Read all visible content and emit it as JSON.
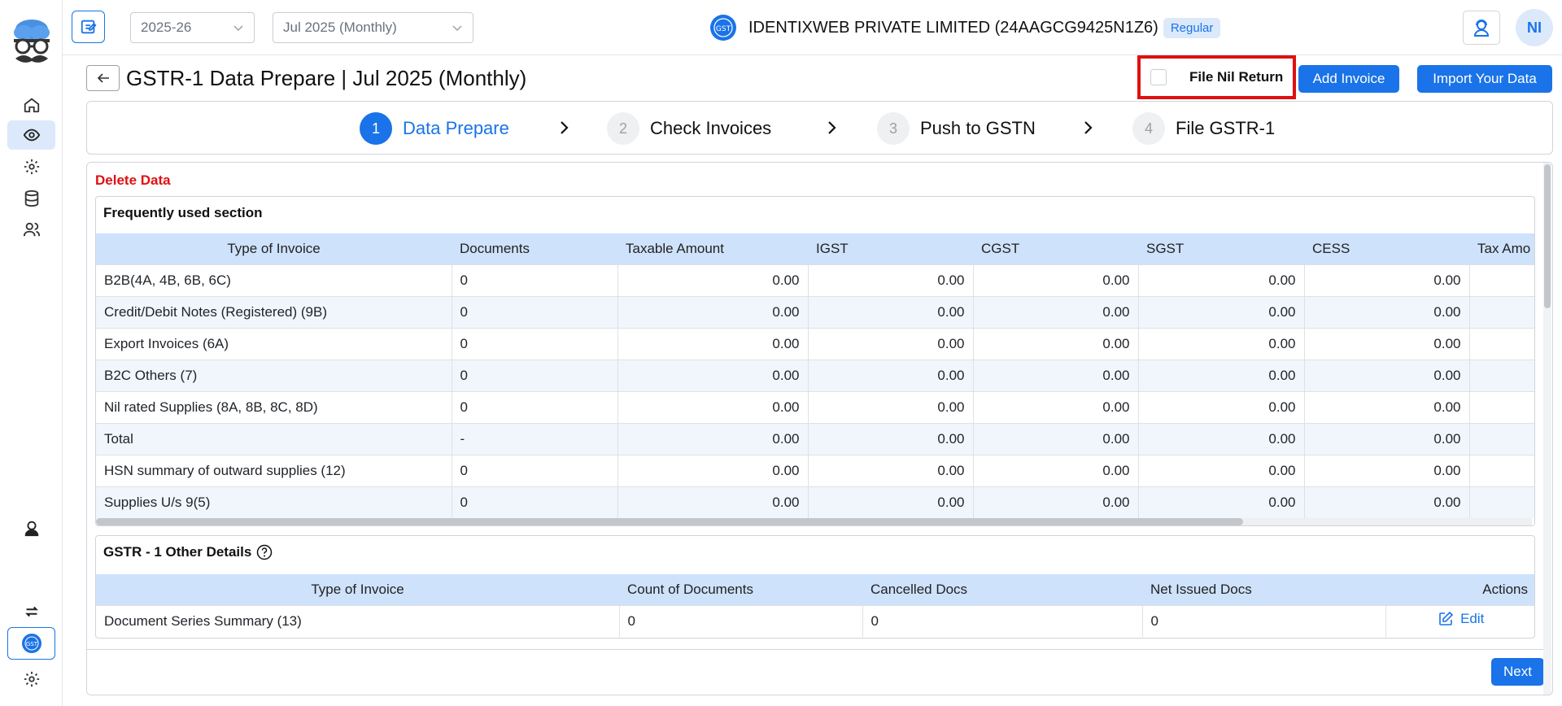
{
  "topbar": {
    "financial_year": "2025-26",
    "period": "Jul 2025 (Monthly)",
    "company_name": "IDENTIXWEB PRIVATE LIMITED (24AAGCG9425N1Z6)",
    "company_type_badge": "Regular",
    "gst_logo_text": "GST",
    "avatar_initials": "NI"
  },
  "page": {
    "title": "GSTR-1 Data Prepare | Jul 2025 (Monthly)",
    "file_nil_return_label": "File Nil Return",
    "add_invoice_label": "Add Invoice",
    "import_label": "Import Your Data",
    "delete_data_label": "Delete Data",
    "next_label": "Next"
  },
  "steps": [
    {
      "num": "1",
      "label": "Data Prepare"
    },
    {
      "num": "2",
      "label": "Check Invoices"
    },
    {
      "num": "3",
      "label": "Push to GSTN"
    },
    {
      "num": "4",
      "label": "File GSTR-1"
    }
  ],
  "frequent": {
    "title": "Frequently used section",
    "headers": [
      "Type of Invoice",
      "Documents",
      "Taxable Amount",
      "IGST",
      "CGST",
      "SGST",
      "CESS",
      "Tax Amo"
    ],
    "rows": [
      [
        "B2B(4A, 4B, 6B, 6C)",
        "0",
        "0.00",
        "0.00",
        "0.00",
        "0.00",
        "0.00",
        ""
      ],
      [
        "Credit/Debit Notes (Registered) (9B)",
        "0",
        "0.00",
        "0.00",
        "0.00",
        "0.00",
        "0.00",
        ""
      ],
      [
        "Export Invoices (6A)",
        "0",
        "0.00",
        "0.00",
        "0.00",
        "0.00",
        "0.00",
        ""
      ],
      [
        "B2C Others (7)",
        "0",
        "0.00",
        "0.00",
        "0.00",
        "0.00",
        "0.00",
        ""
      ],
      [
        "Nil rated Supplies (8A, 8B, 8C, 8D)",
        "0",
        "0.00",
        "0.00",
        "0.00",
        "0.00",
        "0.00",
        ""
      ],
      [
        "Total",
        "-",
        "0.00",
        "0.00",
        "0.00",
        "0.00",
        "0.00",
        ""
      ],
      [
        "HSN summary of outward supplies (12)",
        "0",
        "0.00",
        "0.00",
        "0.00",
        "0.00",
        "0.00",
        ""
      ],
      [
        "Supplies U/s 9(5)",
        "0",
        "0.00",
        "0.00",
        "0.00",
        "0.00",
        "0.00",
        ""
      ]
    ]
  },
  "other": {
    "title": "GSTR - 1 Other Details",
    "headers": [
      "Type of Invoice",
      "Count of Documents",
      "Cancelled Docs",
      "Net Issued Docs",
      "Actions"
    ],
    "rows": [
      [
        "Document Series Summary (13)",
        "0",
        "0",
        "0",
        "Edit"
      ]
    ]
  },
  "colors": {
    "accent": "#1a73e8",
    "danger": "#e01010",
    "header_bg": "#cfe2fb"
  }
}
